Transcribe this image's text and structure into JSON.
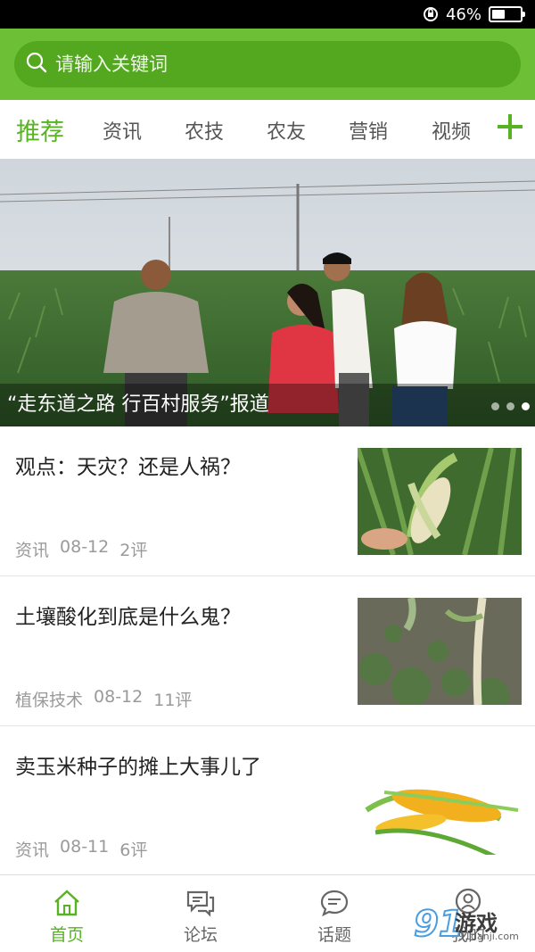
{
  "status_bar": {
    "battery_text": "46%",
    "battery_level": 0.46
  },
  "search": {
    "placeholder": "请输入关键词"
  },
  "tabs": [
    {
      "label": "推荐",
      "active": true
    },
    {
      "label": "资讯",
      "active": false
    },
    {
      "label": "农技",
      "active": false
    },
    {
      "label": "农友",
      "active": false
    },
    {
      "label": "营销",
      "active": false
    },
    {
      "label": "视频",
      "active": false
    }
  ],
  "banner": {
    "caption": "“走东道之路 行百村服务”报道",
    "slide_count": 3,
    "active_slide": 3
  },
  "news": [
    {
      "title": "观点：天灾？还是人祸？",
      "category": "资讯",
      "date": "08-12",
      "comments": "2评"
    },
    {
      "title": "土壤酸化到底是什么鬼？",
      "category": "植保技术",
      "date": "08-12",
      "comments": "11评"
    },
    {
      "title": "卖玉米种子的摊上大事儿了",
      "category": "资讯",
      "date": "08-11",
      "comments": "6评"
    }
  ],
  "bottom_nav": [
    {
      "label": "首页",
      "icon": "home-icon",
      "active": true
    },
    {
      "label": "论坛",
      "icon": "forum-icon",
      "active": false
    },
    {
      "label": "话题",
      "icon": "topic-icon",
      "active": false
    },
    {
      "label": "我的",
      "icon": "profile-icon",
      "active": false
    }
  ],
  "watermark": {
    "text": "游戏",
    "sub": "91danji.com",
    "logo": "91"
  },
  "colors": {
    "accent": "#58b322",
    "header": "#6dbf35",
    "search_box": "#53a81f"
  }
}
